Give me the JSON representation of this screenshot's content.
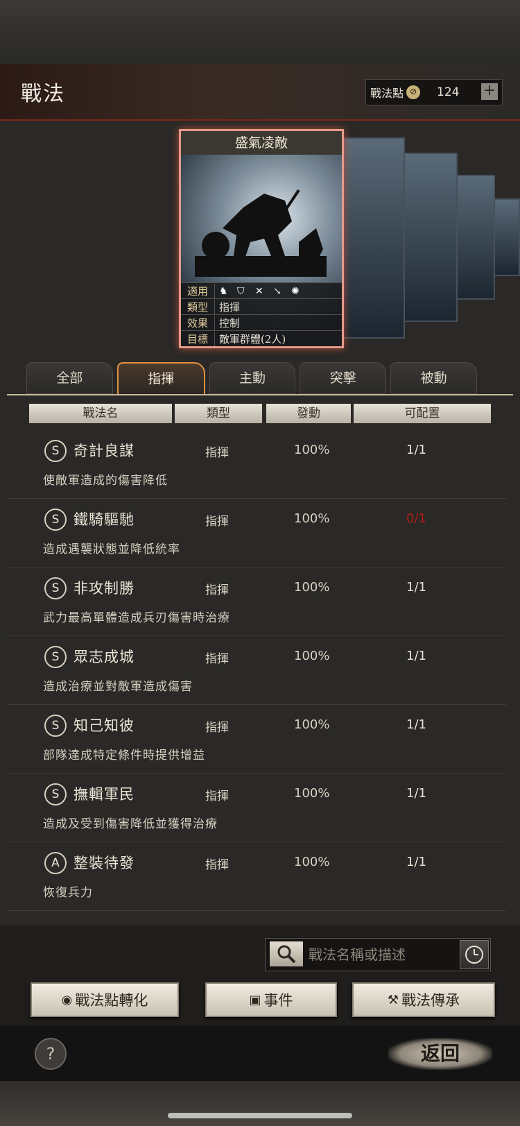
{
  "header": {
    "title": "戰法",
    "points_label": "戰法點",
    "points_value": "124",
    "plus": "+"
  },
  "card": {
    "name": "盛氣凌敵",
    "rows": [
      {
        "k": "適用",
        "v": ""
      },
      {
        "k": "類型",
        "v": "指揮"
      },
      {
        "k": "效果",
        "v": "控制"
      },
      {
        "k": "目標",
        "v": "敵軍群體(2人)"
      }
    ]
  },
  "tabs": [
    "全部",
    "指揮",
    "主動",
    "突擊",
    "被動"
  ],
  "columns": [
    "戰法名",
    "類型",
    "發動",
    "可配置"
  ],
  "tactics": [
    {
      "grade": "S",
      "name": "奇計良謀",
      "type": "指揮",
      "rate": "100%",
      "avail": "1/1",
      "desc": "使敵軍造成的傷害降低"
    },
    {
      "grade": "S",
      "name": "鐵騎驅馳",
      "type": "指揮",
      "rate": "100%",
      "avail": "0/1",
      "desc": "造成遇襲狀態並降低統率"
    },
    {
      "grade": "S",
      "name": "非攻制勝",
      "type": "指揮",
      "rate": "100%",
      "avail": "1/1",
      "desc": "武力最高單體造成兵刃傷害時治療"
    },
    {
      "grade": "S",
      "name": "眾志成城",
      "type": "指揮",
      "rate": "100%",
      "avail": "1/1",
      "desc": "造成治療並對敵軍造成傷害"
    },
    {
      "grade": "S",
      "name": "知己知彼",
      "type": "指揮",
      "rate": "100%",
      "avail": "1/1",
      "desc": "部隊達成特定條件時提供增益"
    },
    {
      "grade": "S",
      "name": "撫輯軍民",
      "type": "指揮",
      "rate": "100%",
      "avail": "1/1",
      "desc": "造成及受到傷害降低並獲得治療"
    },
    {
      "grade": "A",
      "name": "整裝待發",
      "type": "指揮",
      "rate": "100%",
      "avail": "1/1",
      "desc": "恢復兵力"
    }
  ],
  "search": {
    "placeholder": "戰法名稱或描述"
  },
  "buttons": {
    "convert": "戰法點轉化",
    "event": "事件",
    "inherit": "戰法傳承"
  },
  "footer": {
    "help": "?",
    "back": "返回"
  },
  "colors": {
    "accent": "#e3913f",
    "unavailable": "#b01e14"
  }
}
